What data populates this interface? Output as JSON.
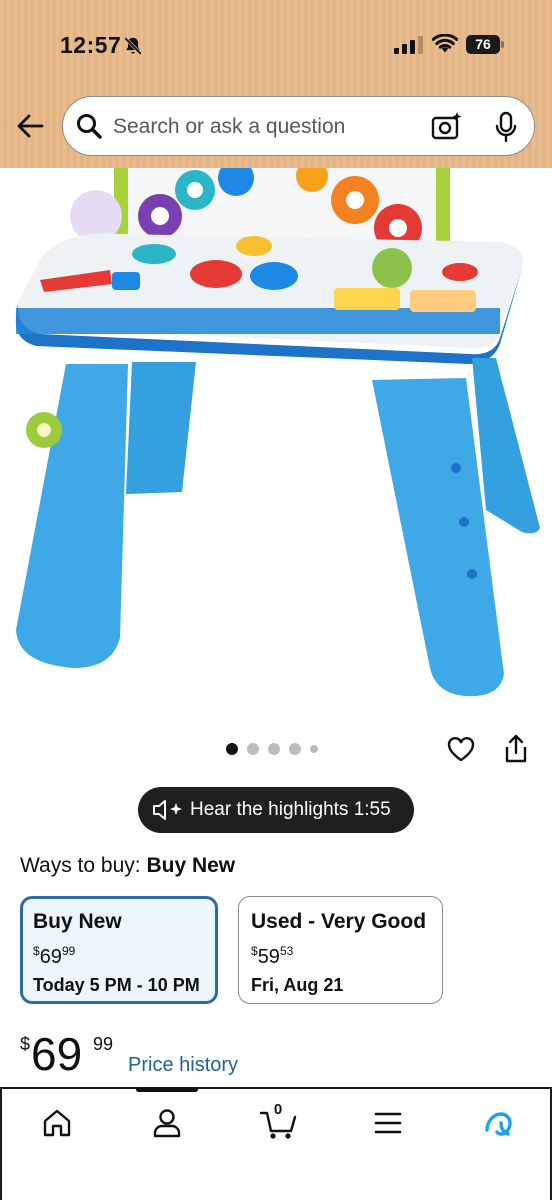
{
  "status_bar": {
    "time": "12:57",
    "battery_percent": "76",
    "icons": [
      "bell-slash-icon",
      "cellular-signal-icon",
      "wifi-icon",
      "battery-icon"
    ]
  },
  "search": {
    "placeholder": "Search or ask a question",
    "icons": [
      "back-arrow-icon",
      "search-icon",
      "camera-lens-icon",
      "microphone-icon"
    ]
  },
  "product_image": {
    "gallery_dot_count": 5,
    "active_dot_index": 0
  },
  "actions": {
    "icons": [
      "heart-icon",
      "share-icon"
    ]
  },
  "hear_highlights": {
    "label": "Hear the highlights 1:55",
    "icon": "speaker-sparkle-icon"
  },
  "ways_to_buy": {
    "prefix": "Ways to buy:",
    "selected": "Buy New",
    "options": [
      {
        "title": "Buy New",
        "price_currency": "$",
        "price_whole": "69",
        "price_fraction": "99",
        "delivery": "Today 5 PM - 10 PM",
        "selected": true
      },
      {
        "title": "Used - Very Good",
        "price_currency": "$",
        "price_whole": "59",
        "price_fraction": "53",
        "delivery": "Fri, Aug 21",
        "selected": false
      }
    ]
  },
  "price": {
    "currency": "$",
    "whole": "69",
    "fraction": "99",
    "history_link": "Price history"
  },
  "bottom_nav": {
    "cart_count": "0",
    "items": [
      "home-icon",
      "account-icon",
      "cart-icon",
      "menu-icon",
      "alexa-icon"
    ]
  },
  "colors": {
    "header_bg": "#e8b98a",
    "selected_border": "#2c6aa6",
    "selected_bg": "#edf6fd",
    "link": "#2162a1",
    "alexa": "#1da1f2"
  }
}
